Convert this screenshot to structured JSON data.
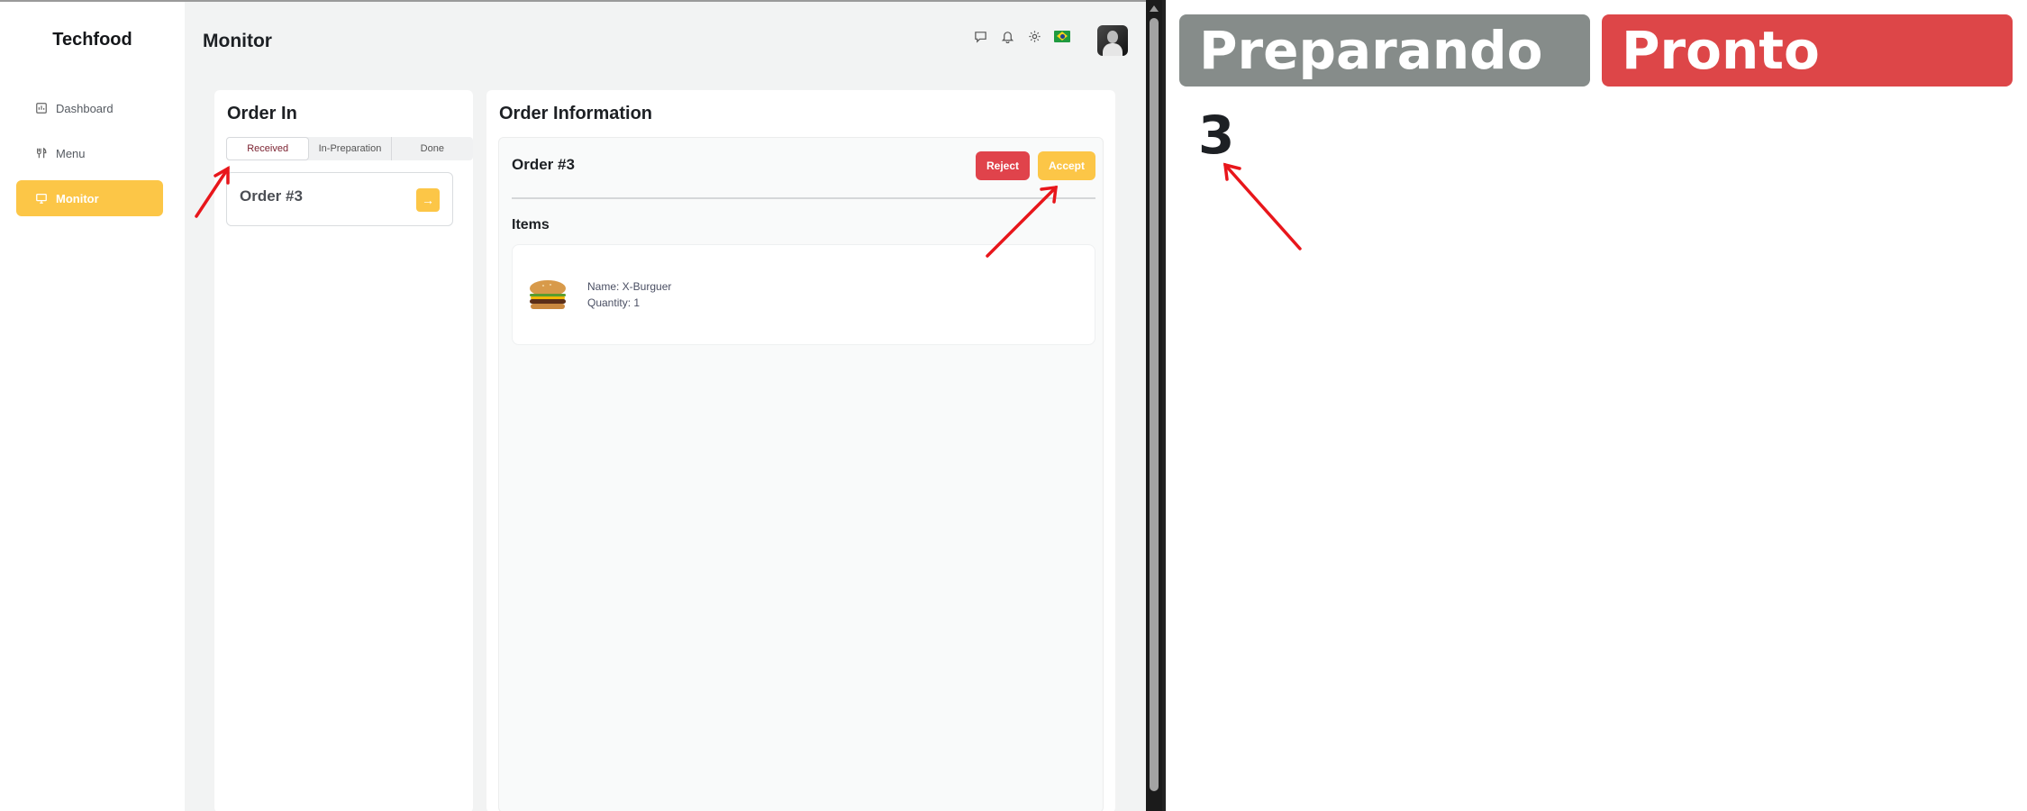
{
  "app": {
    "brand": "Techfood",
    "page_title": "Monitor",
    "sidebar": {
      "items": [
        {
          "label": "Dashboard",
          "icon": "dashboard-icon",
          "active": false
        },
        {
          "label": "Menu",
          "icon": "utensils-icon",
          "active": false
        },
        {
          "label": "Monitor",
          "icon": "monitor-icon",
          "active": true
        }
      ]
    },
    "header_icons": [
      "chat-icon",
      "bell-icon",
      "gear-icon",
      "brazil-flag-icon",
      "avatar"
    ],
    "order_in": {
      "title": "Order In",
      "tabs": [
        {
          "label": "Received",
          "active": true
        },
        {
          "label": "In-Preparation",
          "active": false
        },
        {
          "label": "Done",
          "active": false
        }
      ],
      "orders": [
        {
          "label": "Order #3"
        }
      ]
    },
    "order_info": {
      "title": "Order Information",
      "order_label": "Order #3",
      "reject_label": "Reject",
      "accept_label": "Accept",
      "items_title": "Items",
      "items": [
        {
          "name": "Name: X-Burguer",
          "quantity": "Quantity: 1"
        }
      ]
    }
  },
  "display": {
    "preparando_label": "Preparando",
    "pronto_label": "Pronto",
    "order_number": "3"
  },
  "colors": {
    "accent": "#fcc647",
    "reject": "#e0434b",
    "preparando": "#868c8a",
    "pronto": "#dd4648",
    "annotation_arrow": "#e8161b"
  }
}
